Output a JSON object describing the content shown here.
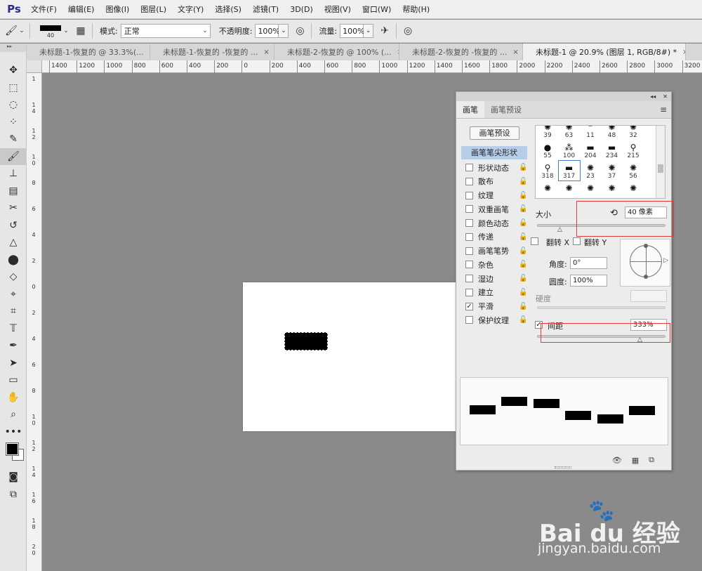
{
  "app": {
    "logo": "Ps"
  },
  "menu": [
    "文件(F)",
    "编辑(E)",
    "图像(I)",
    "图层(L)",
    "文字(Y)",
    "选择(S)",
    "滤镜(T)",
    "3D(D)",
    "视图(V)",
    "窗口(W)",
    "帮助(H)"
  ],
  "options": {
    "brush_size": "40",
    "mode_label": "模式:",
    "mode_value": "正常",
    "opacity_label": "不透明度:",
    "opacity_value": "100%",
    "flow_label": "流量:",
    "flow_value": "100%"
  },
  "tabs": [
    {
      "label": "未标题-1-恢复的 @ 33.3%(...",
      "close": "×"
    },
    {
      "label": "未标题-1-恢复的 -恢复的 ...",
      "close": "×"
    },
    {
      "label": "未标题-2-恢复的 @ 100% (...",
      "close": "×"
    },
    {
      "label": "未标题-2-恢复的 -恢复的 ...",
      "close": "×"
    },
    {
      "label": "未标题-1 @ 20.9% (图层 1, RGB/8#) *",
      "close": "×"
    }
  ],
  "ruler": {
    "h_labels": [
      "1400",
      "1200",
      "1000",
      "800",
      "600",
      "400",
      "200",
      "0",
      "200",
      "400",
      "600",
      "800",
      "1000",
      "1200",
      "1400",
      "1600",
      "1800",
      "2000",
      "2200",
      "2400",
      "2600",
      "2800",
      "3000",
      "3200"
    ],
    "v_labels": [
      "1",
      "14",
      "12",
      "10",
      "8",
      "6",
      "4",
      "2",
      "0",
      "2",
      "4",
      "6",
      "8",
      "10",
      "12",
      "14",
      "16",
      "18",
      "20"
    ]
  },
  "panel": {
    "tab_brush": "画笔",
    "tab_presets": "画笔预设",
    "preset_button": "画笔预设",
    "tip_shape": "画笔笔尖形状",
    "options": [
      {
        "label": "形状动态",
        "checked": false
      },
      {
        "label": "散布",
        "checked": false
      },
      {
        "label": "纹理",
        "checked": false
      },
      {
        "label": "双重画笔",
        "checked": false
      },
      {
        "label": "颜色动态",
        "checked": false
      },
      {
        "label": "传递",
        "checked": false
      },
      {
        "label": "画笔笔势",
        "checked": false
      },
      {
        "label": "杂色",
        "checked": false
      },
      {
        "label": "湿边",
        "checked": false
      },
      {
        "label": "建立",
        "checked": false
      },
      {
        "label": "平滑",
        "checked": true
      },
      {
        "label": "保护纹理",
        "checked": false
      }
    ],
    "brush_numbers": [
      "39",
      "63",
      "11",
      "48",
      "32",
      "55",
      "100",
      "204",
      "234",
      "215",
      "318",
      "317",
      "23",
      "37",
      "56"
    ],
    "size_label": "大小",
    "size_value": "40 像素",
    "flip_x": "翻转 X",
    "flip_y": "翻转 Y",
    "angle_label": "角度:",
    "angle_value": "0°",
    "roundness_label": "圆度:",
    "roundness_value": "100%",
    "hardness_label": "硬度",
    "spacing_label": "间距",
    "spacing_value": "333%",
    "lock_icon": "lock-icon",
    "check_mark": "✓"
  },
  "watermark": {
    "brand": "Bai du 经验",
    "url": "jingyan.baidu.com"
  },
  "colors": {
    "accent": "#b8cde8",
    "highlight": "#e03a3a"
  }
}
